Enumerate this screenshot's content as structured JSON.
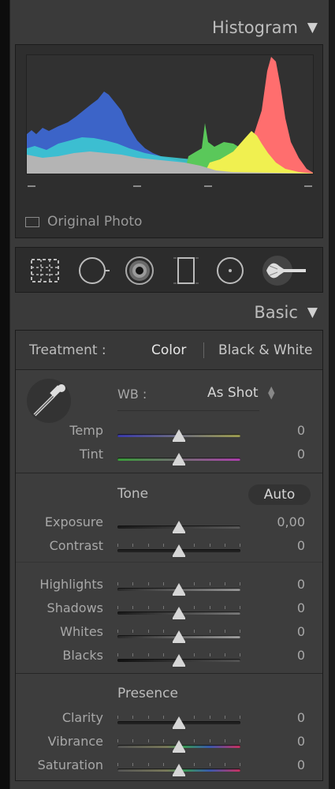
{
  "histogram": {
    "header": "Histogram",
    "original_photo_label": "Original Photo"
  },
  "tools": [
    "crop-overlay-icon",
    "spot-removal-icon",
    "red-eye-icon",
    "graduated-filter-icon",
    "radial-filter-icon",
    "adjustment-brush-icon"
  ],
  "basic": {
    "header": "Basic",
    "treatment_label": "Treatment :",
    "color_label": "Color",
    "bw_label": "Black & White",
    "wb_label": "WB :",
    "wb_value": "As Shot",
    "tone_label": "Tone",
    "auto_label": "Auto",
    "presence_label": "Presence",
    "sliders": {
      "temp": {
        "label": "Temp",
        "value": "0"
      },
      "tint": {
        "label": "Tint",
        "value": "0"
      },
      "exposure": {
        "label": "Exposure",
        "value": "0,00"
      },
      "contrast": {
        "label": "Contrast",
        "value": "0"
      },
      "highlights": {
        "label": "Highlights",
        "value": "0"
      },
      "shadows": {
        "label": "Shadows",
        "value": "0"
      },
      "whites": {
        "label": "Whites",
        "value": "0"
      },
      "blacks": {
        "label": "Blacks",
        "value": "0"
      },
      "clarity": {
        "label": "Clarity",
        "value": "0"
      },
      "vibrance": {
        "label": "Vibrance",
        "value": "0"
      },
      "saturation": {
        "label": "Saturation",
        "value": "0"
      }
    }
  },
  "colors": {
    "temp_gradient": [
      "#3b3bb0",
      "#a0a050"
    ],
    "tint_gradient": [
      "#3aa03a",
      "#b040b0"
    ],
    "hist_blue": "#3c64c8",
    "hist_red": "#ff6464",
    "hist_green": "#5ac85a",
    "hist_yellow": "#f0f050"
  }
}
